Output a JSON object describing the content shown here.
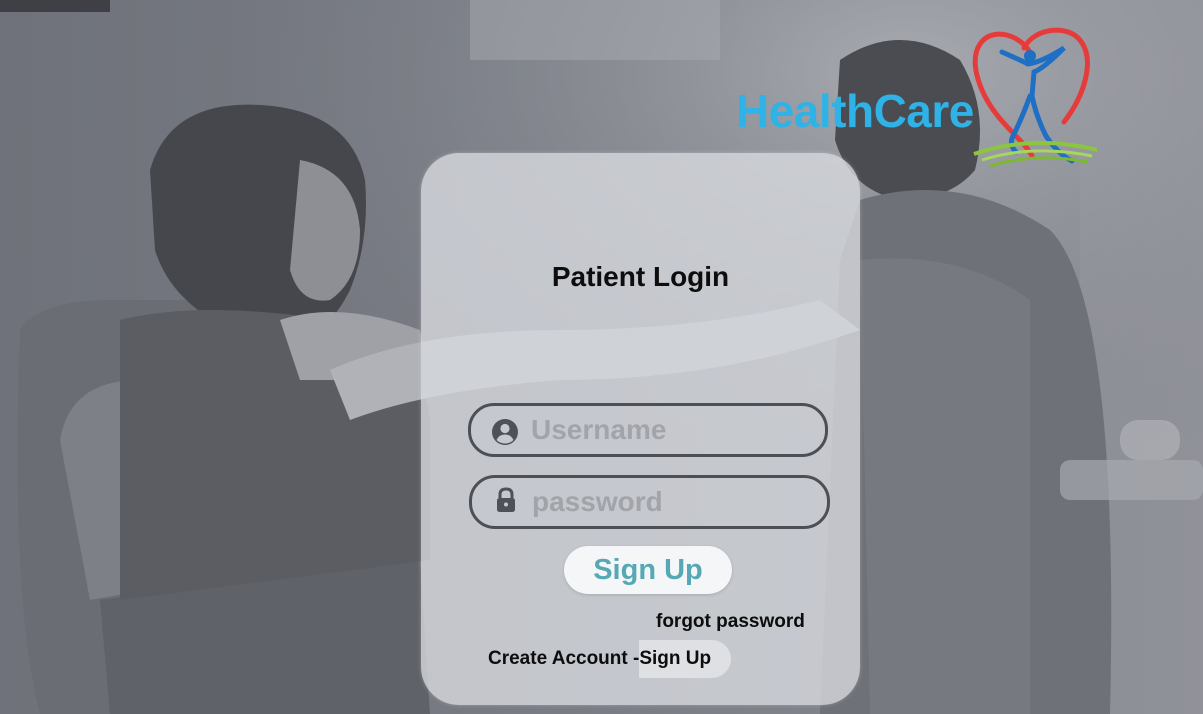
{
  "brand": {
    "name": "HealthCare",
    "text_color": "#2fb3e6",
    "heart_color": "#e63b3b",
    "figure_color": "#1f6fc4",
    "grass_color": "#8cc63f"
  },
  "login": {
    "title": "Patient Login",
    "username_placeholder": "Username",
    "password_placeholder": "password",
    "submit_label": "Sign Up",
    "forgot_label": "forgot password",
    "create_text": "Create Account -",
    "create_link_label": "Sign Up"
  },
  "icons": {
    "username": "user-circle-icon",
    "password": "lock-icon"
  },
  "colors": {
    "submit_text": "#56a9b4",
    "card_background": "#d7d9df"
  }
}
